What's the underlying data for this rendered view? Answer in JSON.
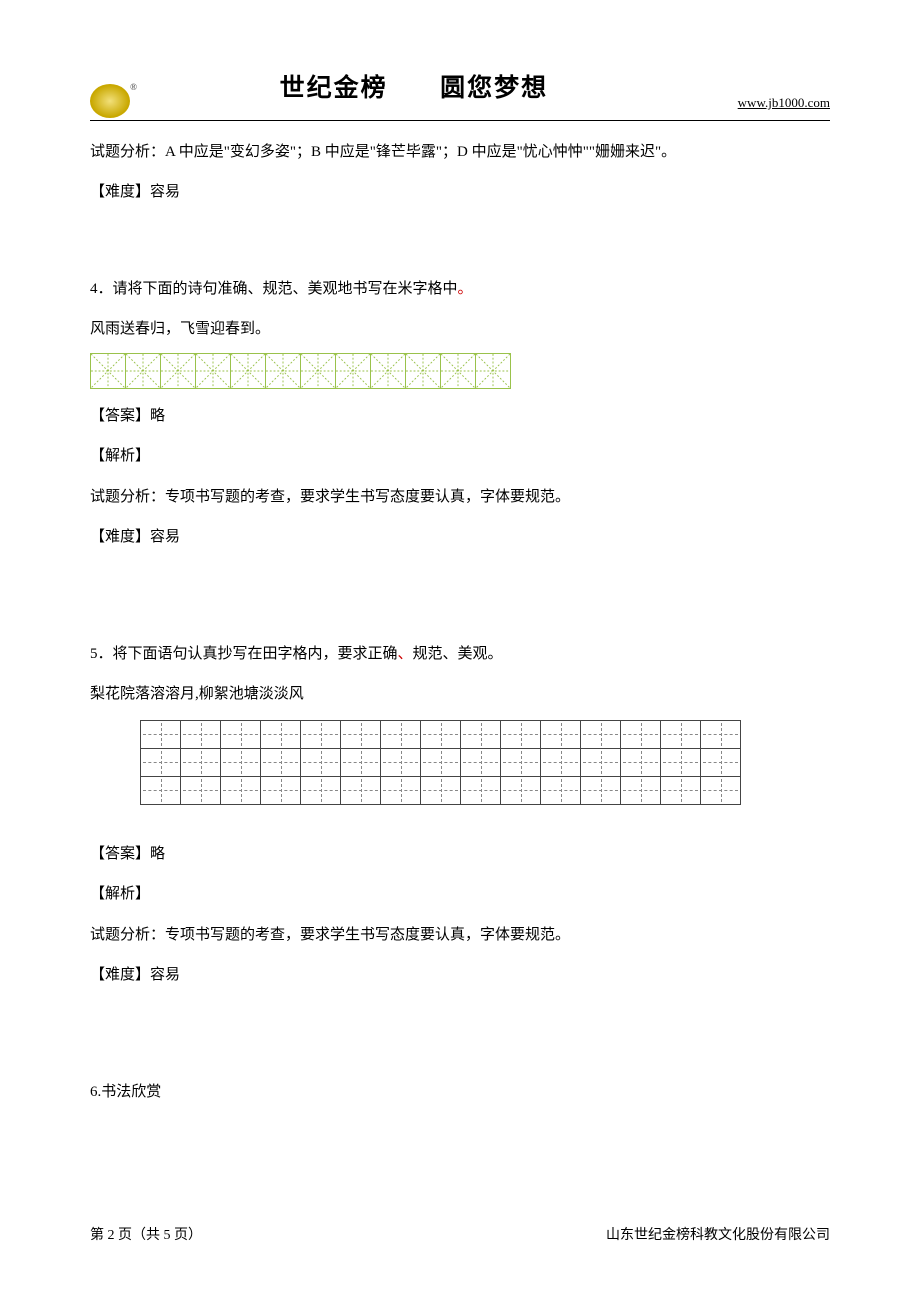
{
  "header": {
    "title_left": "世纪金榜",
    "title_right": "圆您梦想",
    "url": "www.jb1000.com"
  },
  "body": {
    "line1_a": "试题分析：A 中应是\"变幻多姿\"；B 中应是\"锋芒毕露\"；D 中应是\"忧心忡忡\"\"姗姗来迟\"。",
    "diff1": "【难度】容易",
    "q4_a": "4．请将下面的诗句准确、规范、美观地书写在米字格中",
    "q4_b": "。",
    "q4_sentence": "风雨送春归，飞雪迎春到。",
    "ans4": "【答案】略",
    "jiexi4": "【解析】",
    "q4_analysis": "试题分析：专项书写题的考查，要求学生书写态度要认真，字体要规范。",
    "diff4": "【难度】容易",
    "q5_a": "5．将下面语句认真抄写在田字格内，要求正确",
    "q5_b": "、",
    "q5_c": "规范、美观。",
    "q5_sentence": "梨花院落溶溶月,柳絮池塘淡淡风",
    "ans5": "【答案】略",
    "jiexi5": "【解析】",
    "q5_analysis": "试题分析：专项书写题的考查，要求学生书写态度要认真，字体要规范。",
    "diff5": "【难度】容易",
    "q6": "6.书法欣赏"
  },
  "footer": {
    "page": "第 2 页（共 5 页）",
    "company": "山东世纪金榜科教文化股份有限公司"
  }
}
